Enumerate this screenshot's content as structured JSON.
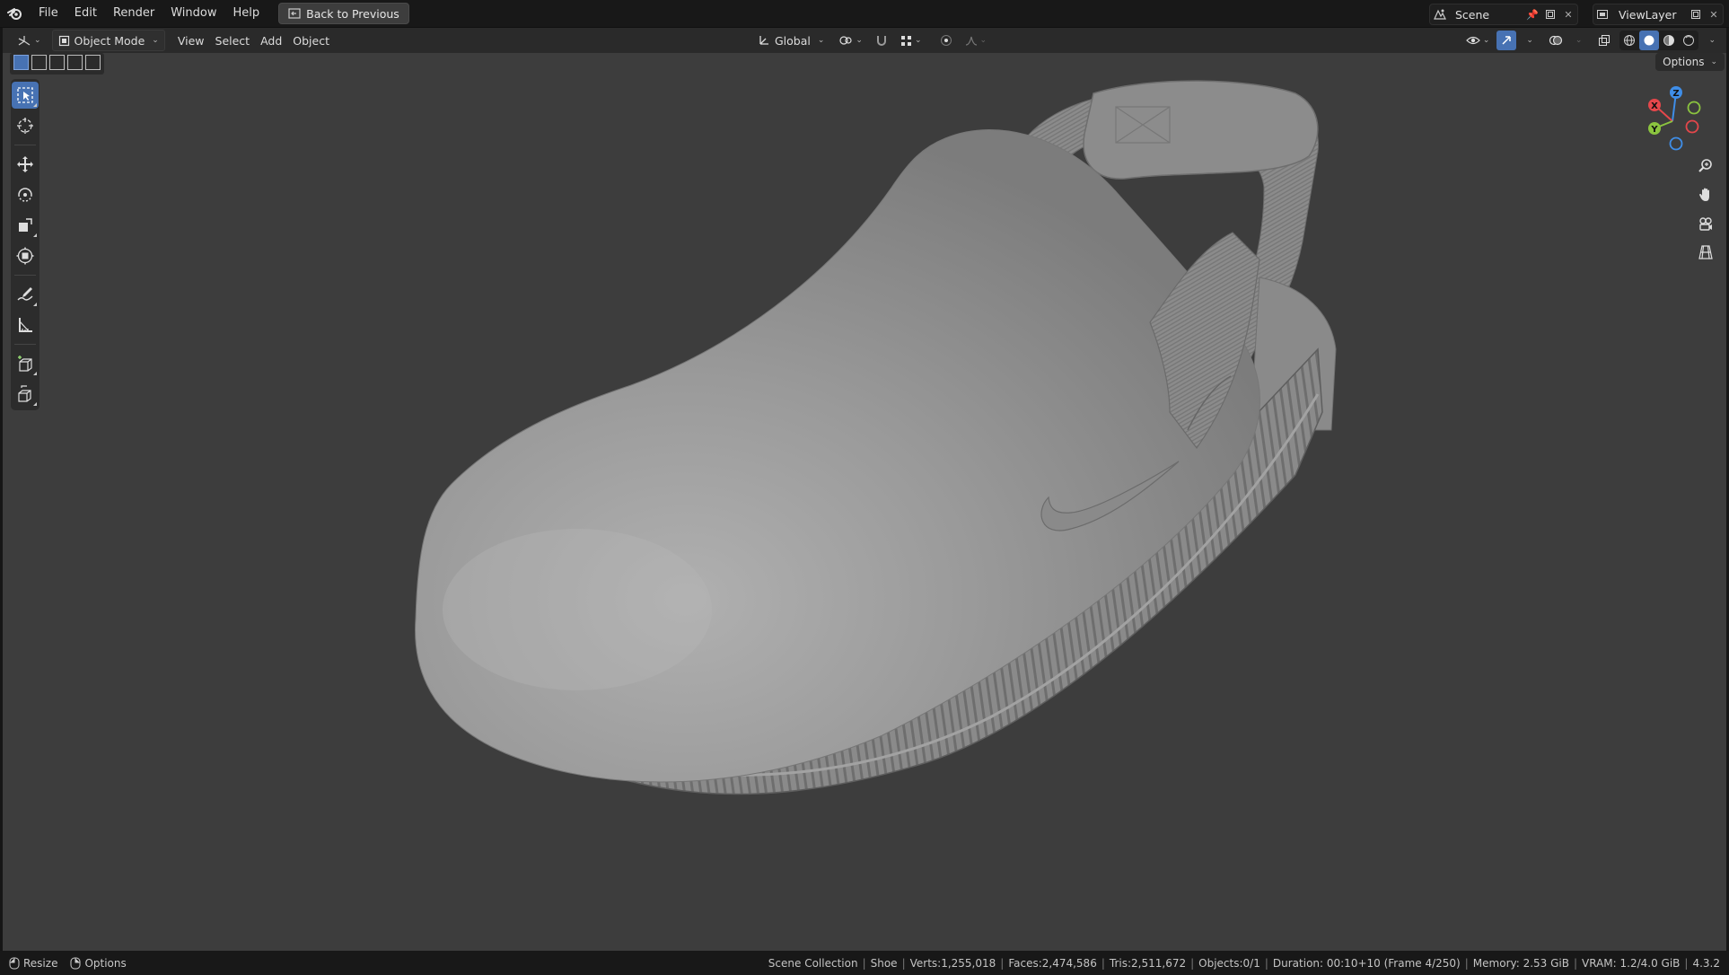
{
  "menubar": {
    "items": [
      "File",
      "Edit",
      "Render",
      "Window",
      "Help"
    ],
    "back_button": "Back to Previous",
    "scene": "Scene",
    "view_layer": "ViewLayer"
  },
  "viewport_header": {
    "mode": "Object Mode",
    "menus": [
      "View",
      "Select",
      "Add",
      "Object"
    ],
    "transform_orientation": "Global"
  },
  "viewport": {
    "options_label": "Options",
    "gizmo_axes": {
      "x": "X",
      "y": "Y",
      "z": "Z"
    },
    "colors": {
      "background": "#3d3d3d",
      "active_tool": "#4772b3",
      "axis_x": "#e5474b",
      "axis_y": "#8bc43f",
      "axis_z": "#3f8ee8"
    }
  },
  "toolbar": {
    "tools": [
      "select-box",
      "cursor",
      "move",
      "rotate",
      "scale",
      "transform",
      "annotate",
      "measure",
      "add-cube",
      "extrude"
    ],
    "active": "select-box"
  },
  "statusbar": {
    "left": {
      "resize": "Resize",
      "options": "Options"
    },
    "collection": "Scene Collection",
    "object": "Shoe",
    "verts": "Verts:1,255,018",
    "faces": "Faces:2,474,586",
    "tris": "Tris:2,511,672",
    "objects": "Objects:0/1",
    "duration": "Duration: 00:10+10 (Frame 4/250)",
    "memory": "Memory: 2.53 GiB",
    "vram": "VRAM: 1.2/4.0 GiB",
    "version": "4.3.2"
  }
}
